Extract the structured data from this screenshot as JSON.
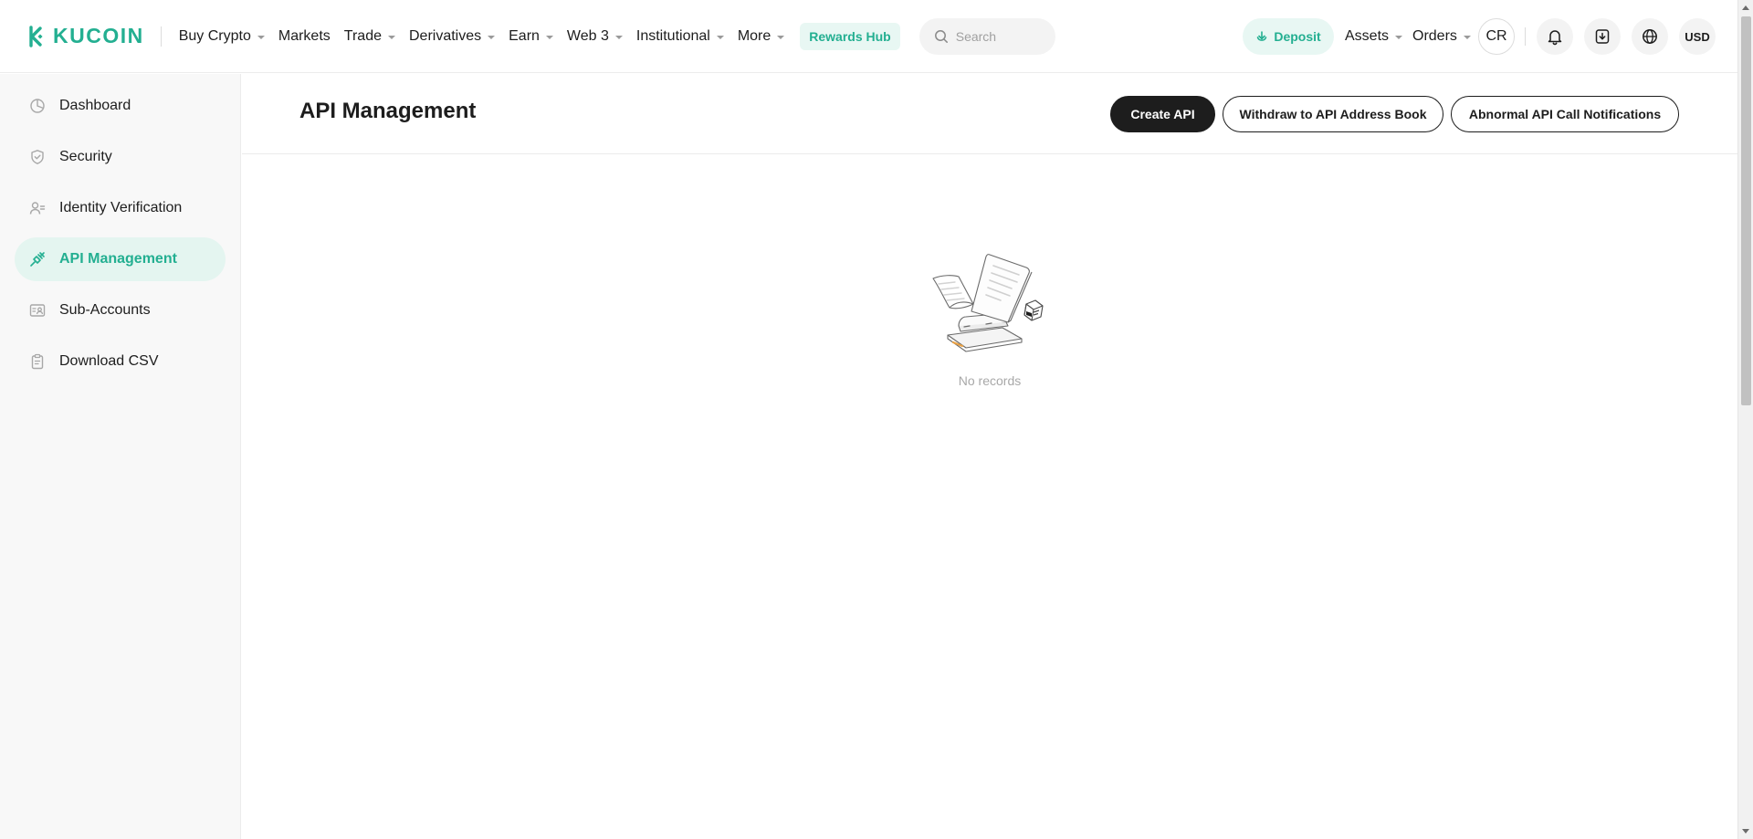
{
  "brand": {
    "name": "KUCOIN",
    "color": "#23af91",
    "logo_icon": "kucoin-logo-icon"
  },
  "nav": {
    "items": [
      {
        "label": "Buy Crypto",
        "dropdown": true
      },
      {
        "label": "Markets",
        "dropdown": false
      },
      {
        "label": "Trade",
        "dropdown": true
      },
      {
        "label": "Derivatives",
        "dropdown": true
      },
      {
        "label": "Earn",
        "dropdown": true
      },
      {
        "label": "Web 3",
        "dropdown": true
      },
      {
        "label": "Institutional",
        "dropdown": true
      },
      {
        "label": "More",
        "dropdown": true
      }
    ],
    "rewards_label": "Rewards Hub"
  },
  "search": {
    "placeholder": "Search",
    "icon": "search-icon"
  },
  "header_right": {
    "deposit_label": "Deposit",
    "assets_label": "Assets",
    "orders_label": "Orders",
    "avatar_initials": "CR",
    "currency_label": "USD",
    "icons": [
      "bell-icon",
      "download-app-icon",
      "globe-icon"
    ]
  },
  "sidebar": {
    "items": [
      {
        "label": "Dashboard",
        "icon": "pie-chart-icon",
        "active": false
      },
      {
        "label": "Security",
        "icon": "shield-check-icon",
        "active": false
      },
      {
        "label": "Identity Verification",
        "icon": "user-id-icon",
        "active": false
      },
      {
        "label": "API Management",
        "icon": "api-plug-icon",
        "active": true
      },
      {
        "label": "Sub-Accounts",
        "icon": "sub-accounts-icon",
        "active": false
      },
      {
        "label": "Download CSV",
        "icon": "clipboard-icon",
        "active": false
      }
    ]
  },
  "main": {
    "title": "API Management",
    "buttons": {
      "create": "Create API",
      "withdraw_book": "Withdraw to API Address Book",
      "abnormal": "Abnormal API Call Notifications"
    },
    "empty_text": "No records",
    "empty_illustration": "empty-records-illustration"
  },
  "colors": {
    "accent": "#23af91",
    "accent_bg": "#e4f5f0",
    "primary_button": "#1d1d1d",
    "text": "#1d1d1d",
    "muted": "#a8a8a8"
  }
}
